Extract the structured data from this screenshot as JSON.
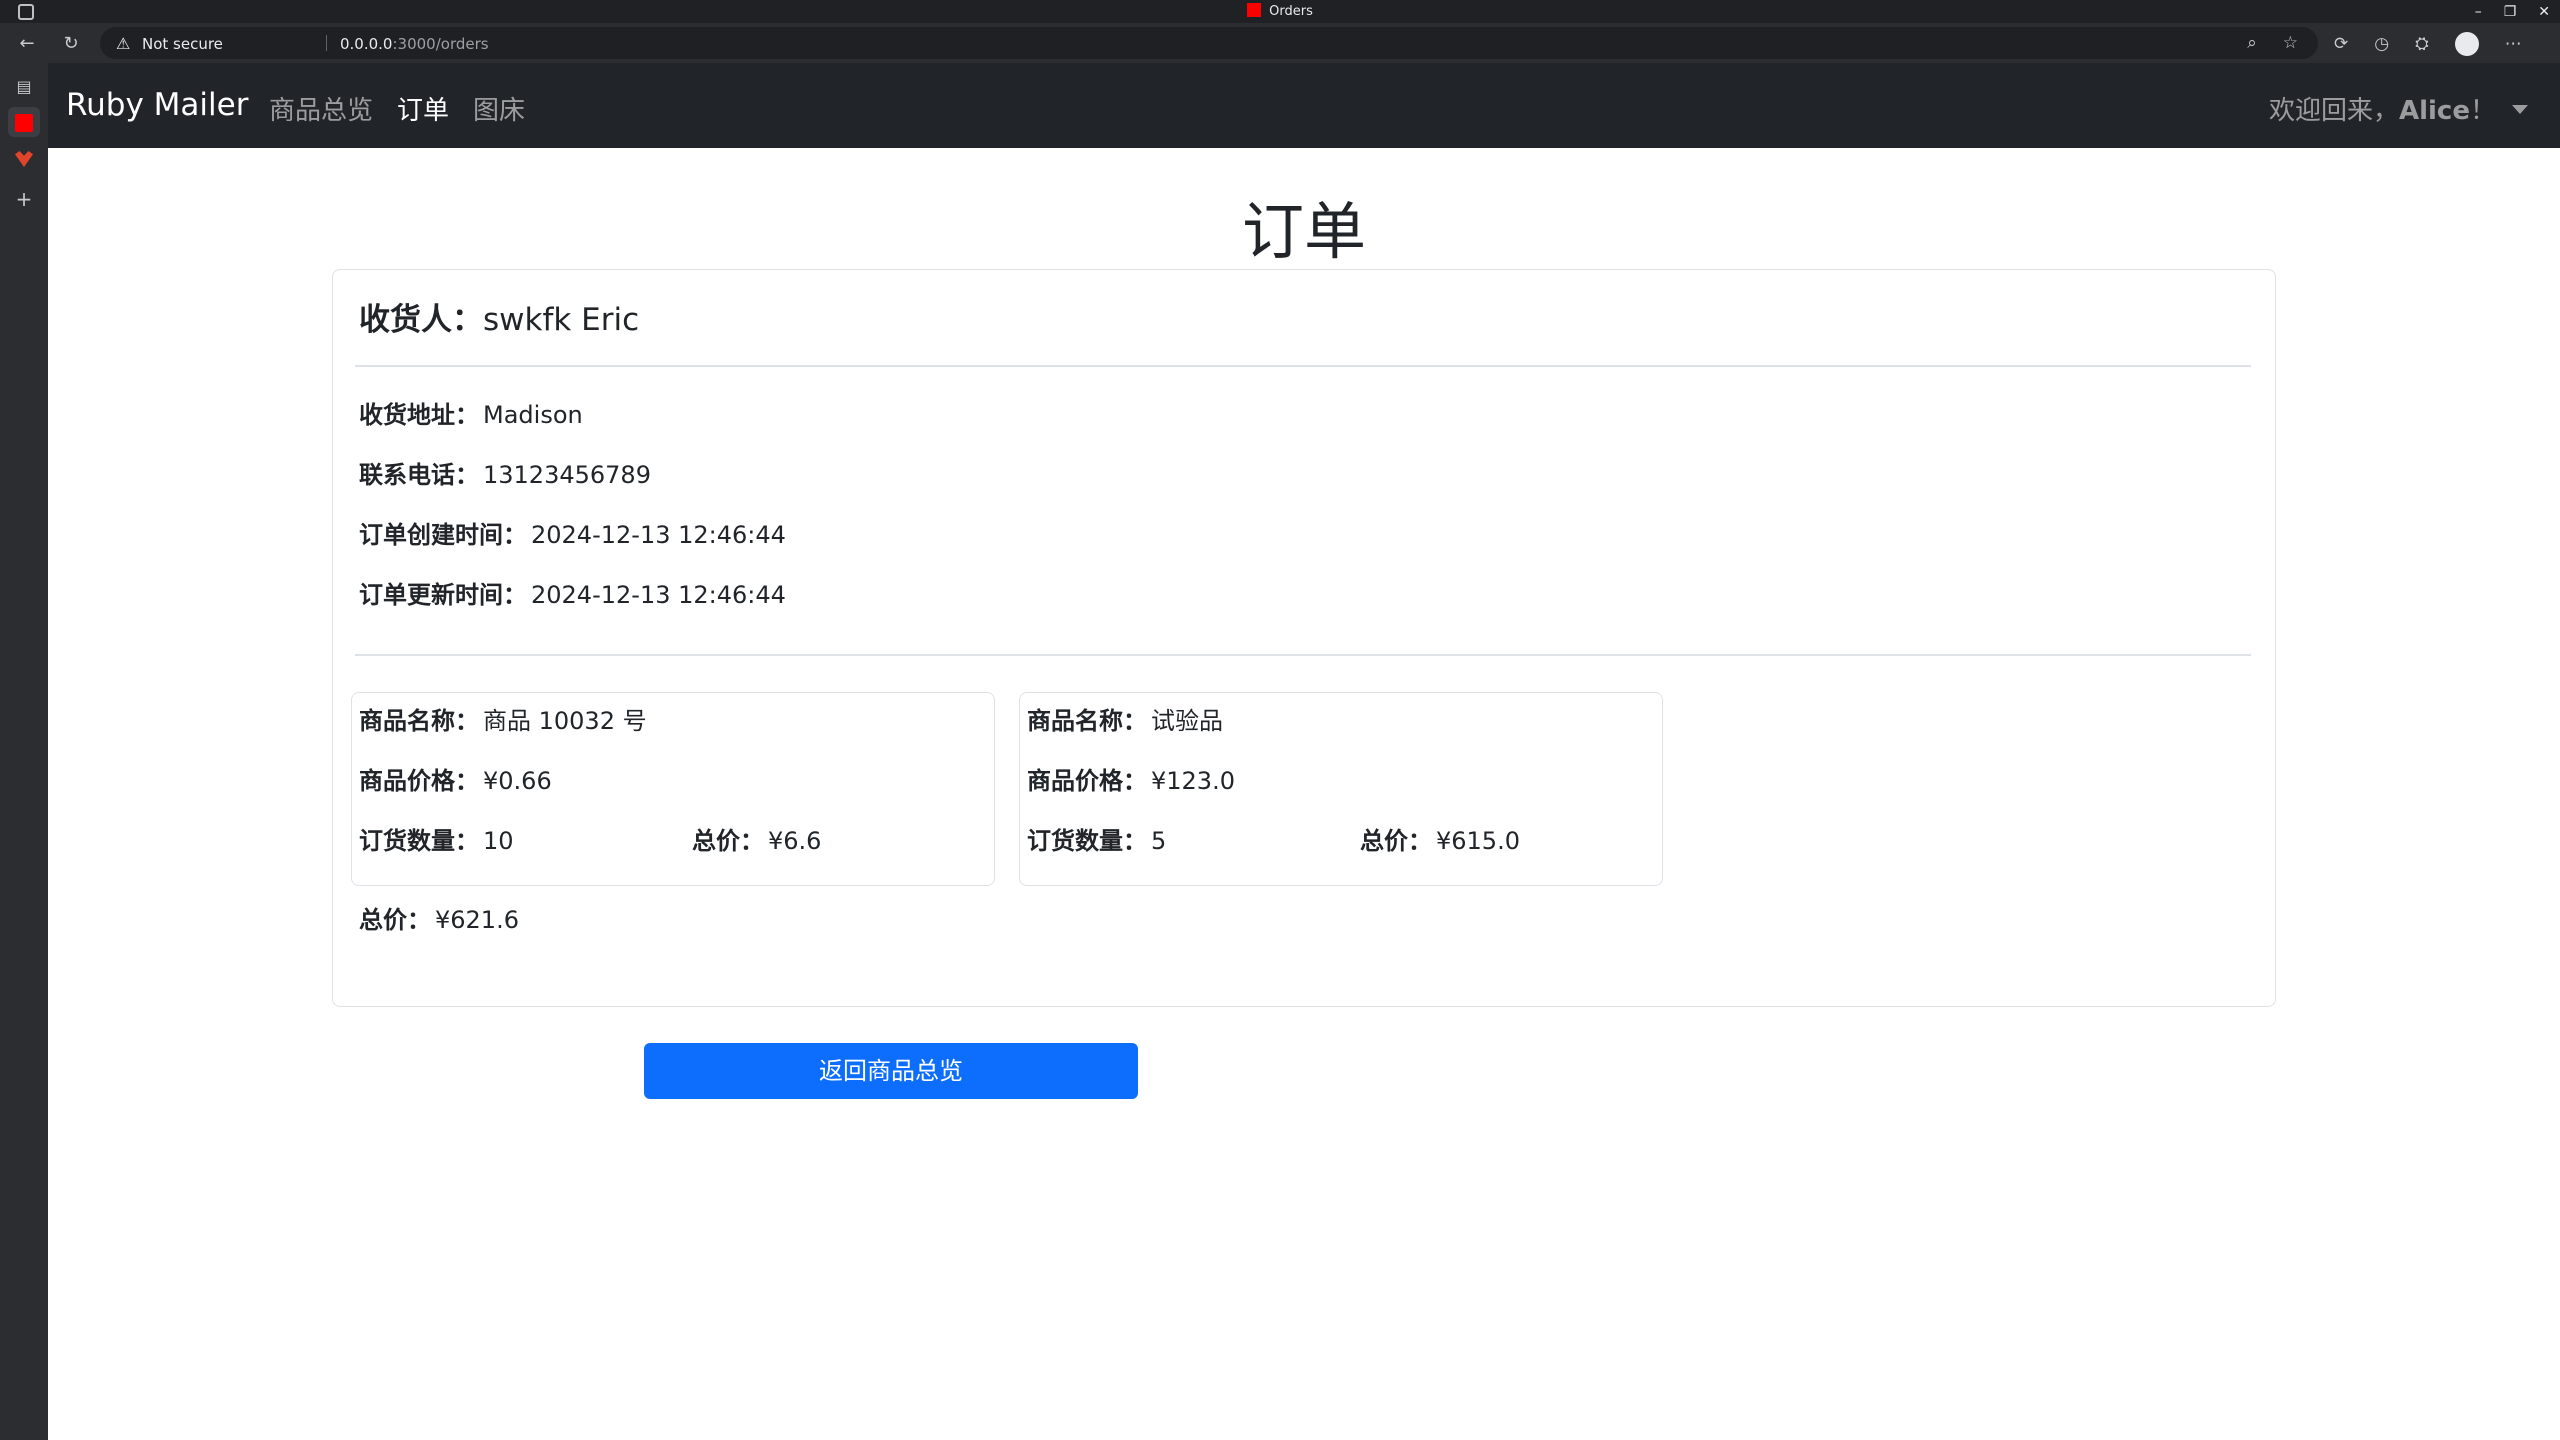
{
  "browser": {
    "tab_title": "Orders",
    "security_label": "Not secure",
    "url_host": "0.0.0.0",
    "url_path": ":3000/orders"
  },
  "navbar": {
    "brand": "Ruby Mailer",
    "links": [
      {
        "label": "商品总览",
        "active": false
      },
      {
        "label": "订单",
        "active": true
      },
      {
        "label": "图床",
        "active": false
      }
    ],
    "welcome_prefix": "欢迎回来，",
    "user_name": "Alice",
    "welcome_suffix": "！"
  },
  "page": {
    "title": "订单"
  },
  "order": {
    "recipient_label": "收货人：",
    "recipient": "swkfk Eric",
    "address_label": "收货地址：",
    "address": "Madison",
    "phone_label": "联系电话：",
    "phone": "13123456789",
    "created_label": "订单创建时间：",
    "created": "2024-12-13 12:46:44",
    "updated_label": "订单更新时间：",
    "updated": "2024-12-13 12:46:44",
    "items": [
      {
        "name_label": "商品名称：",
        "name": "商品 10032 号",
        "price_label": "商品价格：",
        "price": "¥0.66",
        "qty_label": "订货数量：",
        "qty": "10",
        "subtotal_label": "总价：",
        "subtotal": "¥6.6"
      },
      {
        "name_label": "商品名称：",
        "name": "试验品",
        "price_label": "商品价格：",
        "price": "¥123.0",
        "qty_label": "订货数量：",
        "qty": "5",
        "subtotal_label": "总价：",
        "subtotal": "¥615.0"
      }
    ],
    "total_label": "总价：",
    "total": "¥621.6"
  },
  "actions": {
    "back_label": "返回商品总览"
  }
}
